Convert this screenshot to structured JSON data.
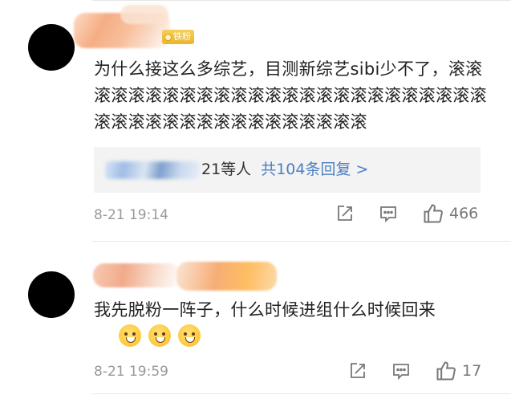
{
  "comments": [
    {
      "badge": "铁粉",
      "text": "为什么接这么多综艺，目测新综艺sibi少不了，滚滚滚滚滚滚滚滚滚滚滚滚滚滚滚滚滚滚滚滚滚滚滚滚滚滚滚滚滚滚滚滚滚滚滚滚滚滚滚滚滚",
      "reply_box": {
        "visible_suffix": "21等人",
        "total": "共104条回复 >"
      },
      "time": "8-21 19:14",
      "likes": "466",
      "icons": [
        "share-icon",
        "comment-icon",
        "like-icon"
      ]
    },
    {
      "text": "我先脱粉一阵子，什么时候进组什么时候回来",
      "emojis": [
        "hug-emoji",
        "hug-emoji",
        "hug-emoji"
      ],
      "time": "8-21 19:59",
      "likes": "17",
      "icons": [
        "share-icon",
        "comment-icon",
        "like-icon"
      ]
    }
  ]
}
